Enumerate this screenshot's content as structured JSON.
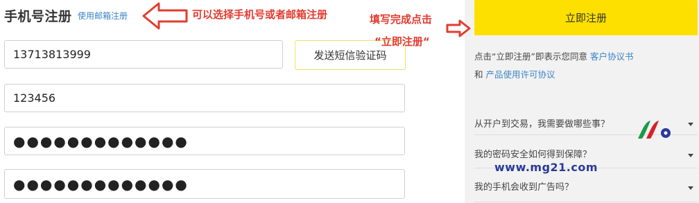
{
  "form": {
    "title": "手机号注册",
    "switch_link": "使用邮箱注册",
    "phone_value": "13713813999",
    "sms_button_label": "发送短信验证码",
    "code_value": "123456",
    "password_value": "●●●●●●●●●●●●●",
    "confirm_value": "●●●●●●●●●●●●●"
  },
  "annotations": {
    "switch_note": "可以选择手机号或者邮箱注册",
    "submit_note_line1": "填写完成点击",
    "submit_note_line2": "“立即注册“"
  },
  "panel": {
    "register_button": "立即注册",
    "agree_prefix": "点击“立即注册”即表示您同意",
    "agree_link_1": "客户协议书",
    "agree_and": "和",
    "agree_link_2": "产品使用许可协议",
    "faq": [
      {
        "question": "从开户到交易，我需要做哪些事？"
      },
      {
        "question": "我的密码安全如何得到保障？"
      },
      {
        "question": "我的手机会收到广告吗？"
      }
    ],
    "watermark_text": "www.mg21.com"
  },
  "colors": {
    "accent_yellow": "#fde000",
    "link_blue": "#3b84c6",
    "annotation_red": "#e33b2f",
    "panel_bg": "#f2f2f2"
  }
}
